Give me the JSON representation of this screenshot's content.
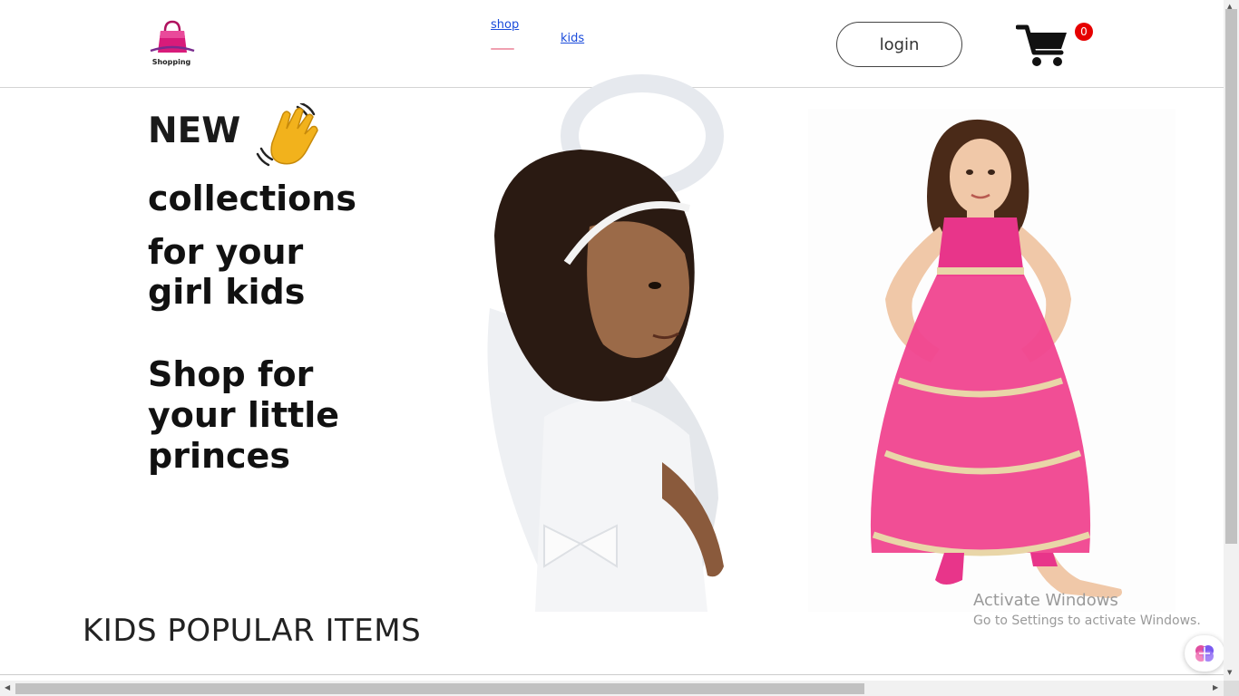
{
  "navbar": {
    "logo_text": "Shopping",
    "links": {
      "shop": "shop",
      "kids": "kids"
    },
    "login_label": "login",
    "cart_count": "0"
  },
  "hero": {
    "line_new": "NEW",
    "line_collections": "collections",
    "line_for_your": "for your",
    "line_girl_kids": "girl kids",
    "line_shop_for": "Shop for",
    "line_your_little": "your little",
    "line_princes": "princes"
  },
  "section": {
    "title": "KIDS POPULAR ITEMS"
  },
  "watermark": {
    "title": "Activate Windows",
    "subtitle": "Go to Settings to activate Windows."
  },
  "colors": {
    "link": "#1a4bdb",
    "badge": "#e60000",
    "brand_pink": "#e0157f",
    "dress_pink": "#f0448f"
  },
  "icons": [
    "shopping-bag-icon",
    "waving-hand-icon",
    "cart-icon",
    "assistant-icon"
  ]
}
